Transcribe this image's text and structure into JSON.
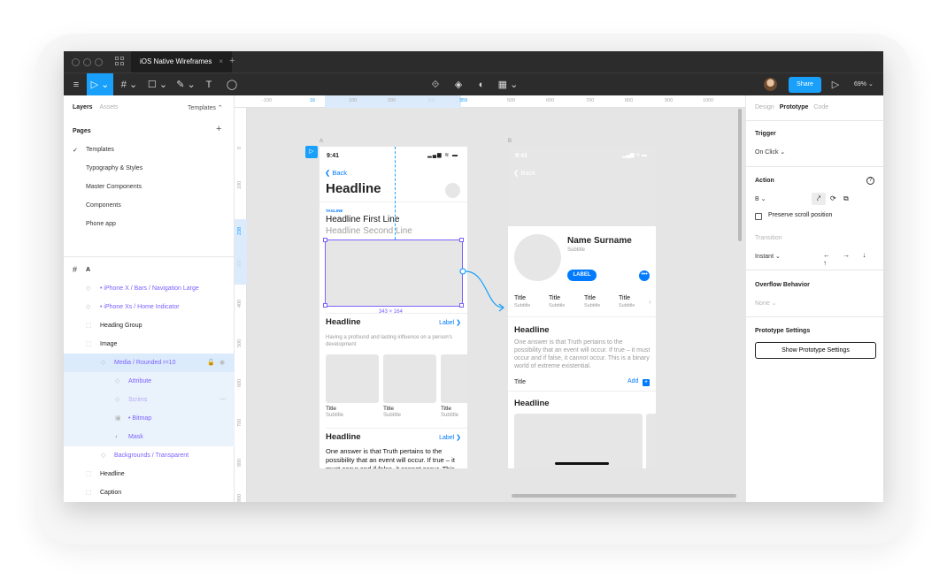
{
  "tab": {
    "title": "iOS Native Wireframes",
    "close": "×",
    "add": "+"
  },
  "toolbar": {
    "menu_icon": "≡",
    "move_tool": "▷ ⌄",
    "frame_tool": "# ⌄",
    "shape_tool": "☐ ⌄",
    "pen_tool": "✎ ⌄",
    "text_tool": "T",
    "comment_tool": "◯",
    "component_icons": [
      "⟐",
      "◈",
      "◐",
      "▦ ⌄"
    ],
    "share_label": "Share",
    "present_icon": "▷",
    "zoom": "69% ⌄"
  },
  "left_panel": {
    "tab_layers": "Layers",
    "tab_assets": "Assets",
    "templates_dropdown": "Templates ⌃",
    "pages_title": "Pages",
    "pages_add": "+",
    "checkmark": "✓",
    "pages": [
      "Templates",
      "Typography & Styles",
      "Master Components",
      "Components",
      "Phone app"
    ],
    "layers": [
      {
        "icon": "#",
        "label": "A"
      },
      {
        "icon": "◇",
        "label": "• iPhone X / Bars / Navigation Large"
      },
      {
        "icon": "◇",
        "label": "• iPhone Xs / Home Indicator"
      },
      {
        "icon": "⬚",
        "label": "Heading Group"
      },
      {
        "icon": "⬚",
        "label": "Image"
      },
      {
        "icon": "◇",
        "label": "Media / Rounded r=10",
        "lock": "🔓",
        "eye": "◉"
      },
      {
        "icon": "◇",
        "label": "Attribute"
      },
      {
        "icon": "◇",
        "label": "Scrims",
        "eye": "〰"
      },
      {
        "icon": "▣",
        "label": "• Bitmap"
      },
      {
        "icon": "◐",
        "label": "Mask"
      },
      {
        "icon": "◇",
        "label": "Backgrounds / Transparent"
      },
      {
        "icon": "⬚",
        "label": "Headline"
      },
      {
        "icon": "⬚",
        "label": "Caption"
      }
    ]
  },
  "rulers": {
    "top": [
      "-100",
      "16",
      "100",
      "200",
      "300",
      "359",
      "500",
      "600",
      "700",
      "800",
      "900",
      "1000"
    ],
    "left": [
      "0",
      "100",
      "238",
      "300",
      "400",
      "500",
      "600",
      "700",
      "800",
      "900"
    ]
  },
  "canvas": {
    "frame_a": "A",
    "frame_b": "B",
    "play": "▷",
    "phone_a": {
      "time": "9:41",
      "status": "▂▄▆ ≋ ▬",
      "back": "❮ Back",
      "headline": "Headline",
      "tagline": "TAGLINE",
      "headline_first": "Headline First Line",
      "headline_second": "Headline Second Line",
      "dimensions": "343 × 164",
      "section1_headline": "Headline",
      "section1_label": "Label ❯",
      "section1_desc": "Having a profound and lasting influence on a person's development",
      "tiles": [
        {
          "title": "Title",
          "subtitle": "Subtitle"
        },
        {
          "title": "Title",
          "subtitle": "Subtitle"
        },
        {
          "title": "Title",
          "subtitle": "Subtitle"
        }
      ],
      "section2_headline": "Headline",
      "section2_label": "Label ❯",
      "section2_body": "One answer is that Truth pertains to the possibility that an event will occur. If true – it must occur and if false, it cannot occur. This"
    },
    "phone_b": {
      "time": "9:41",
      "status": "▂▄▆ ≋ ▬",
      "back": "❮ Back",
      "name": "Name Surname",
      "subtitle": "Subtitle",
      "label_button": "LABEL",
      "more": "•••",
      "tabs": [
        {
          "title": "Title",
          "subtitle": "Subtitle"
        },
        {
          "title": "Title",
          "subtitle": "Subtitle"
        },
        {
          "title": "Title",
          "subtitle": "Subtitle"
        },
        {
          "title": "Title",
          "subtitle": "Subtitle"
        }
      ],
      "chevron": "›",
      "headline": "Headline",
      "desc": "One answer is that Truth pertains to the possibility that an event will occur. If true – it must occur and if false, it cannot occur. This is a binary world of extreme existential.",
      "title": "Title",
      "add": "Add",
      "add_icon": "+",
      "headline2": "Headline"
    }
  },
  "right_panel": {
    "tab_design": "Design",
    "tab_prototype": "Prototype",
    "tab_code": "Code",
    "trigger_title": "Trigger",
    "trigger_value": "On Click ⌄",
    "action_title": "Action",
    "help": "?",
    "action_value": "B ⌄",
    "action_icons": [
      "⤤",
      "⟳",
      "⧉"
    ],
    "preserve_scroll": "Preserve scroll position",
    "transition_title": "Transition",
    "transition_value": "Instant ⌄",
    "direction_arrows": "← → ↓ ↑",
    "overflow_title": "Overflow Behavior",
    "overflow_value": "None ⌄",
    "settings_title": "Prototype Settings",
    "settings_button": "Show Prototype Settings"
  },
  "colors": {
    "accent": "#18a0fb",
    "ios_blue": "#007aff",
    "selection": "#7b61ff",
    "dark_chrome": "#2c2c2c"
  }
}
